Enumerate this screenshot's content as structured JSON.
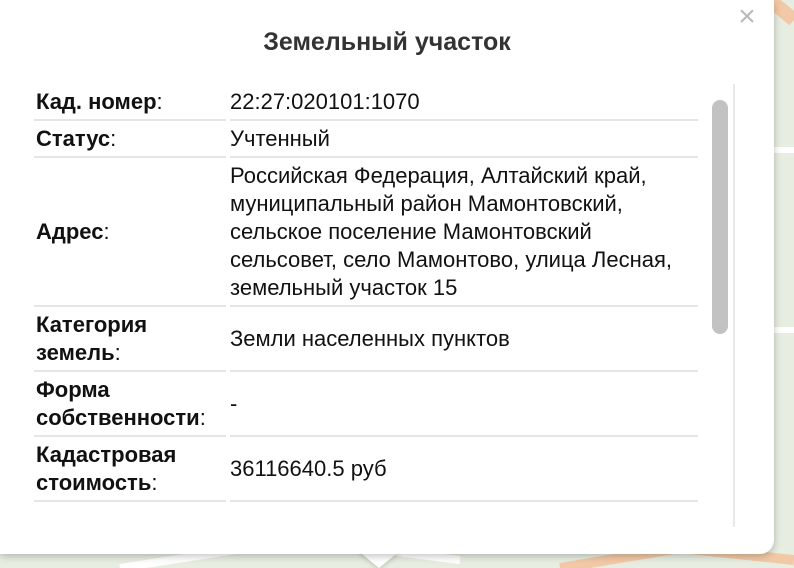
{
  "popup": {
    "title": "Земельный участок",
    "close_glyph": "×",
    "rows": [
      {
        "label": "Кад. номер",
        "value": "22:27:020101:1070"
      },
      {
        "label": "Статус",
        "value": "Учтенный"
      },
      {
        "label": "Адрес",
        "value": "Российская Федерация, Алтайский край, муниципальный район Мамонтовский, сельское поселение Мамонтовский сельсовет, село Мамонтово, улица Лесная, земельный участок 15"
      },
      {
        "label": "Категория земель",
        "value": "Земли населенных пунктов"
      },
      {
        "label": "Форма собственности",
        "value": "-"
      },
      {
        "label": "Кадастровая стоимость",
        "value": "36116640.5 руб"
      }
    ],
    "colon": ":"
  },
  "colors": {
    "map_background": "#e7ede0",
    "road": "#f6d9bf",
    "scrollbar_thumb": "#c2c2c2",
    "close_icon": "#b9b9b9"
  },
  "icons": [
    "close-icon"
  ]
}
